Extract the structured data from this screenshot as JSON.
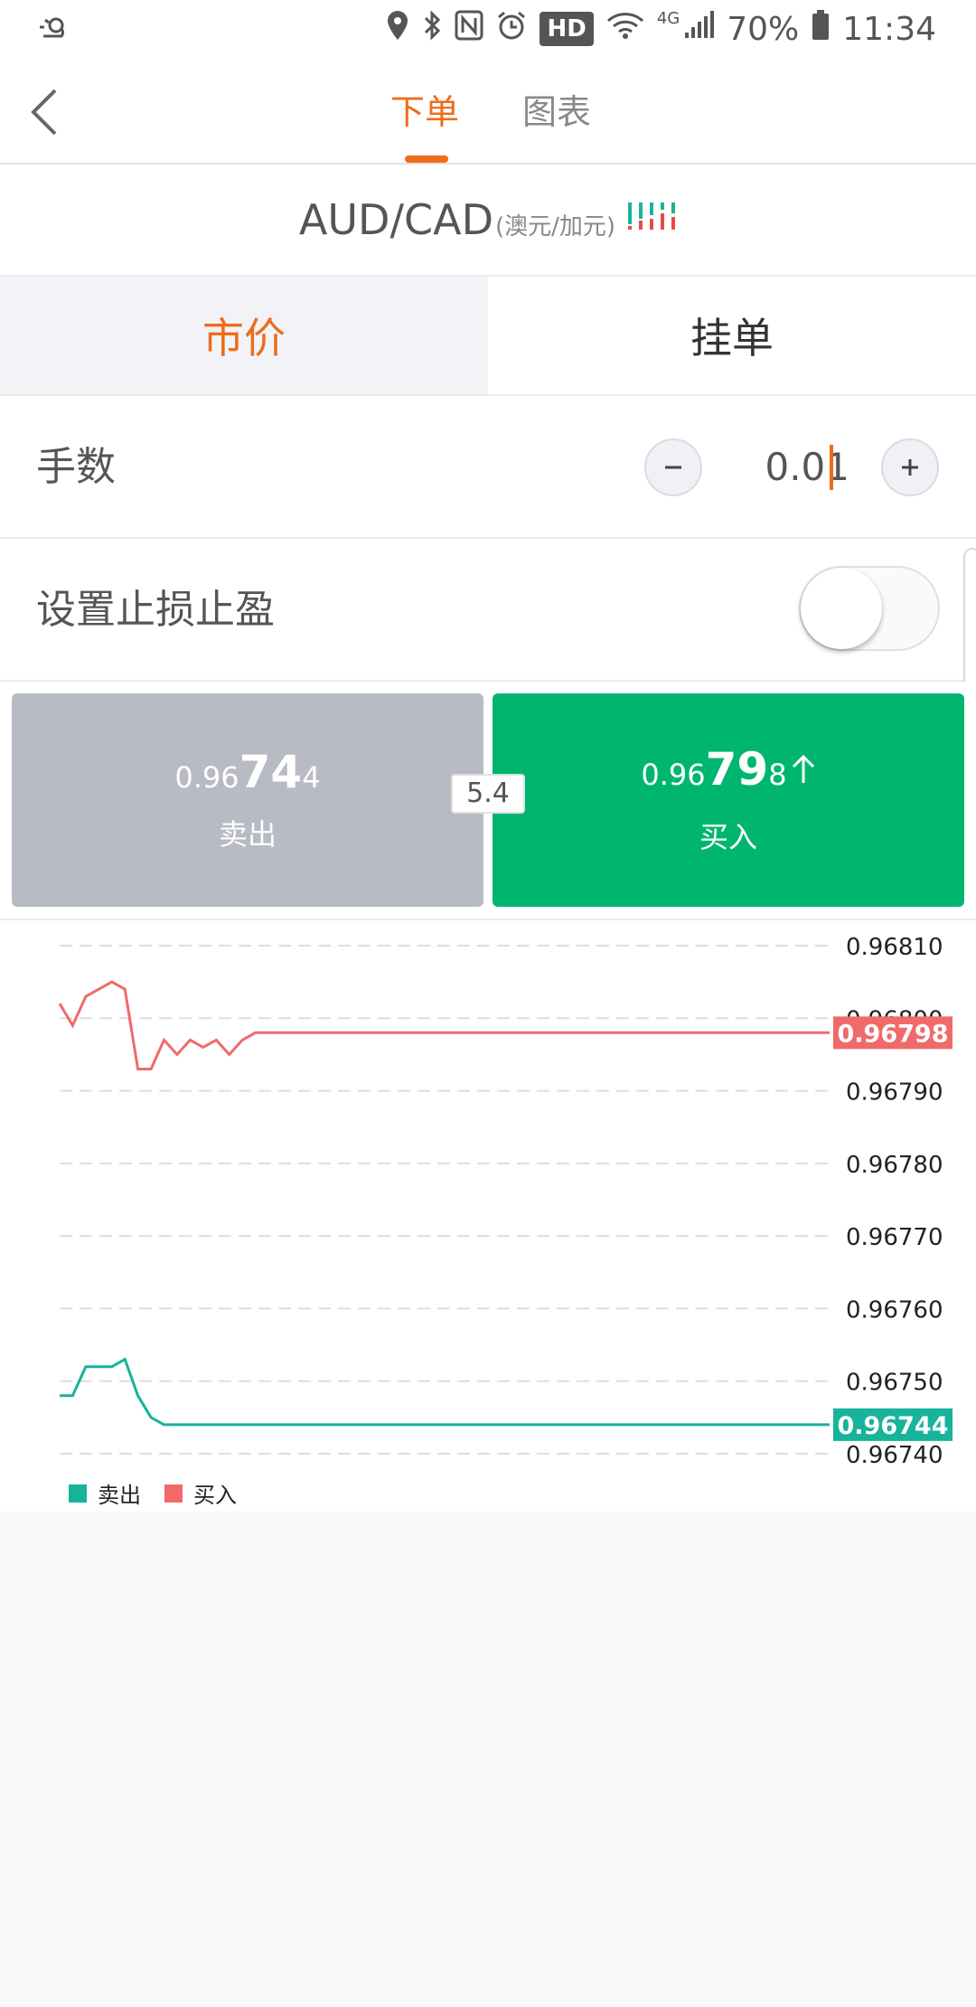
{
  "status_bar": {
    "battery": "70%",
    "time": "11:34",
    "hd": "HD",
    "network": "4G",
    "icons": [
      "weather-icon",
      "location-icon",
      "bluetooth-icon",
      "nfc-icon",
      "alarm-icon",
      "wifi-icon",
      "signal-icon",
      "battery-icon"
    ]
  },
  "header": {
    "tabs": [
      {
        "label": "下单",
        "active": true
      },
      {
        "label": "图表",
        "active": false
      }
    ],
    "accent_color": "#ee6c1b"
  },
  "symbol": {
    "code": "AUD/CAD",
    "name": "(澳元/加元)"
  },
  "order_types": [
    {
      "label": "市价",
      "active": true
    },
    {
      "label": "挂单",
      "active": false
    }
  ],
  "lots": {
    "label": "手数",
    "value": "0.01"
  },
  "sltp": {
    "label": "设置止损止盈",
    "enabled": false
  },
  "trade": {
    "sell": {
      "price_prefix": "0.96",
      "price_big": "74",
      "price_suffix": "4",
      "label": "卖出",
      "color": "#b8bac4"
    },
    "buy": {
      "price_prefix": "0.96",
      "price_big": "79",
      "price_suffix": "8",
      "label": "买入",
      "color": "#00b66e",
      "direction": "up"
    },
    "spread": "5.4"
  },
  "chart_data": {
    "type": "line",
    "ylim": [
      0.9674,
      0.9681
    ],
    "y_ticks": [
      "0.96810",
      "0.96800",
      "0.96790",
      "0.96780",
      "0.96770",
      "0.96760",
      "0.96750",
      "0.96740"
    ],
    "series": [
      {
        "name": "买入",
        "color": "#f06a6a",
        "last_label": "0.96798",
        "values": [
          0.96802,
          0.96799,
          0.96803,
          0.96804,
          0.96805,
          0.96804,
          0.96793,
          0.96793,
          0.96797,
          0.96795,
          0.96797,
          0.96796,
          0.96797,
          0.96795,
          0.96797,
          0.96798,
          0.96798,
          0.96798,
          0.96798,
          0.96798,
          0.96798,
          0.96798,
          0.96798,
          0.96798,
          0.96798,
          0.96798,
          0.96798,
          0.96798,
          0.96798,
          0.96798,
          0.96798,
          0.96798,
          0.96798,
          0.96798,
          0.96798,
          0.96798,
          0.96798,
          0.96798,
          0.96798,
          0.96798,
          0.96798,
          0.96798,
          0.96798,
          0.96798,
          0.96798,
          0.96798,
          0.96798,
          0.96798,
          0.96798,
          0.96798,
          0.96798,
          0.96798,
          0.96798,
          0.96798,
          0.96798,
          0.96798,
          0.96798,
          0.96798,
          0.96798,
          0.96798
        ]
      },
      {
        "name": "卖出",
        "color": "#17b39a",
        "last_label": "0.96744",
        "values": [
          0.96748,
          0.96748,
          0.96752,
          0.96752,
          0.96752,
          0.96753,
          0.96748,
          0.96745,
          0.96744,
          0.96744,
          0.96744,
          0.96744,
          0.96744,
          0.96744,
          0.96744,
          0.96744,
          0.96744,
          0.96744,
          0.96744,
          0.96744,
          0.96744,
          0.96744,
          0.96744,
          0.96744,
          0.96744,
          0.96744,
          0.96744,
          0.96744,
          0.96744,
          0.96744,
          0.96744,
          0.96744,
          0.96744,
          0.96744,
          0.96744,
          0.96744,
          0.96744,
          0.96744,
          0.96744,
          0.96744,
          0.96744,
          0.96744,
          0.96744,
          0.96744,
          0.96744,
          0.96744,
          0.96744,
          0.96744,
          0.96744,
          0.96744,
          0.96744,
          0.96744,
          0.96744,
          0.96744,
          0.96744,
          0.96744,
          0.96744,
          0.96744,
          0.96744,
          0.96744
        ]
      }
    ],
    "legend": [
      {
        "name": "卖出",
        "color": "#17b39a"
      },
      {
        "name": "买入",
        "color": "#f06a6a"
      }
    ],
    "grid": true,
    "legend_position": "bottom-left"
  }
}
